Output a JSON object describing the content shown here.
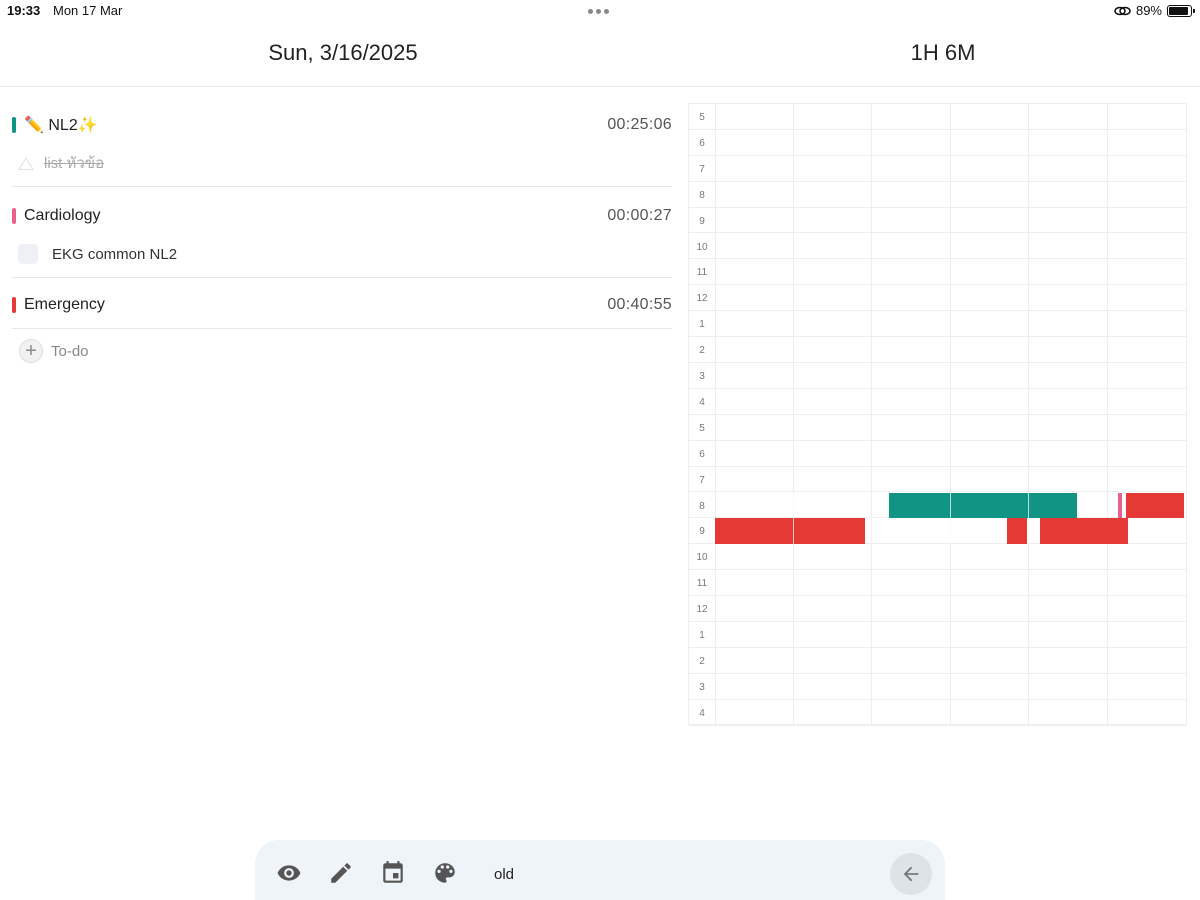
{
  "status_bar": {
    "time": "19:33",
    "date": "Mon 17 Mar",
    "battery": "89%",
    "battery_level": 0.89
  },
  "header": {
    "date": "Sun, 3/16/2025",
    "total": "1H 6M"
  },
  "groups": [
    {
      "title": "✏️ NL2✨",
      "time": "00:25:06",
      "color": "#119484",
      "subtasks": [
        {
          "label": "list หัวข้อ",
          "done": true
        }
      ]
    },
    {
      "title": "Cardiology",
      "time": "00:00:27",
      "color": "#e8628a",
      "subtasks": [
        {
          "label": "EKG common NL2",
          "done": false
        }
      ]
    },
    {
      "title": "Emergency",
      "time": "00:40:55",
      "color": "#e53935",
      "subtasks": []
    }
  ],
  "todo": {
    "label": "To-do"
  },
  "timeline": {
    "hour_labels": [
      "5",
      "6",
      "7",
      "8",
      "9",
      "10",
      "11",
      "12",
      "1",
      "2",
      "3",
      "4",
      "5",
      "6",
      "7",
      "8",
      "9",
      "10",
      "11",
      "12",
      "1",
      "2",
      "3",
      "4"
    ],
    "colors": {
      "nl2": "#119484",
      "cardiology": "#e8628a",
      "emergency": "#e53935"
    }
  },
  "bottom_bar": {
    "icons": [
      "eye-icon",
      "pencil-icon",
      "calendar-icon",
      "palette-icon"
    ],
    "label": "old",
    "back": "arrow-left-icon"
  }
}
